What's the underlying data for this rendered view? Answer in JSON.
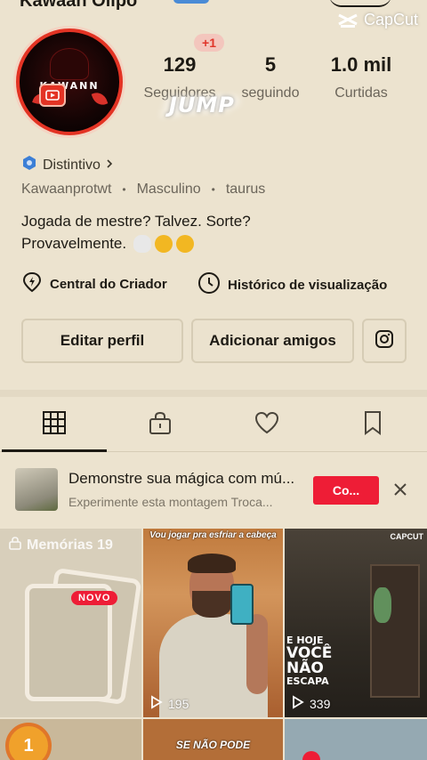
{
  "header": {
    "username": "Kawaan Olipo",
    "capcut_watermark": "CapCut"
  },
  "profile": {
    "avatar_text": "KAWANN",
    "followers_delta": "+1",
    "stats": [
      {
        "value": "129",
        "label": "Seguidores"
      },
      {
        "value": "5",
        "label": "seguindo"
      },
      {
        "value": "1.0 mil",
        "label": "Curtidas"
      }
    ],
    "overlay_sticker": "JUMP",
    "badge_label": "Distintivo",
    "handle": "Kawaanprotwt",
    "gender": "Masculino",
    "sign": "taurus",
    "bio_line1": "Jogada de mestre? Talvez. Sorte?",
    "bio_line2": "Provavelmente."
  },
  "tools": {
    "creator_center": "Central do Criador",
    "watch_history": "Histórico de visualização"
  },
  "actions": {
    "edit_profile": "Editar perfil",
    "add_friends": "Adicionar amigos"
  },
  "promo": {
    "title": "Demonstre sua mágica com mú...",
    "subtitle": "Experimente esta montagem Troca...",
    "button": "Co..."
  },
  "grid": {
    "memories_label": "Memórias 19",
    "new_badge": "NOVO",
    "video2_caption": "Vou jogar pra esfriar a cabeça",
    "video2_views": "195",
    "video3_text_1": "E HOJE",
    "video3_text_2": "VOCÊ",
    "video3_text_3": "NÃO",
    "video3_text_4": "ESCAPA",
    "video3_watermark": "CAPCUT",
    "video3_views": "339",
    "row2_coin": "1",
    "row2_caption": "SE NÃO PODE"
  },
  "colors": {
    "background": "#ece3cf",
    "accent_red": "#ee1d36",
    "text_primary": "#1d1a14",
    "text_secondary": "#6b655a"
  }
}
